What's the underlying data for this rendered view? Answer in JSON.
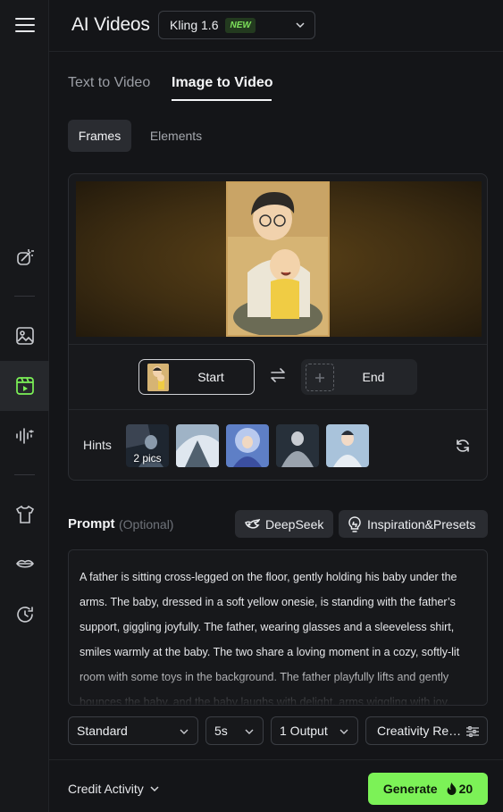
{
  "header": {
    "title": "AI Videos",
    "model": "Kling 1.6",
    "model_badge": "NEW"
  },
  "tabs": [
    {
      "label": "Text to Video",
      "active": false
    },
    {
      "label": "Image to Video",
      "active": true
    }
  ],
  "subtabs": [
    {
      "label": "Frames",
      "active": true
    },
    {
      "label": "Elements",
      "active": false
    }
  ],
  "frames": {
    "start_label": "Start",
    "end_label": "End"
  },
  "hints": {
    "label": "Hints",
    "count_badge": "2 pics"
  },
  "prompt": {
    "label": "Prompt",
    "optional": "(Optional)",
    "deepseek_label": "DeepSeek",
    "inspiration_label": "Inspiration&Presets",
    "text": "A father is sitting cross-legged on the floor, gently holding his baby under the arms. The baby, dressed in a soft yellow onesie, is standing with the father’s support, giggling joyfully. The father, wearing glasses and a sleeveless shirt, smiles warmly at the baby. The two share a loving moment in a cozy, softly-lit room with some toys in the background. The father playfully lifts and gently bounces the baby, and the baby laughs with delight, arms wiggling with joy."
  },
  "options": {
    "mode": "Standard",
    "duration": "5s",
    "outputs": "1 Output",
    "creativity": "Creativity Re…"
  },
  "footer": {
    "credit_label": "Credit Activity",
    "generate_label": "Generate",
    "generate_cost": "20"
  },
  "colors": {
    "accent_green": "#7cf257",
    "background": "#141518"
  },
  "icons": [
    "menu-icon",
    "magic-wand-icon",
    "image-icon",
    "video-icon",
    "audio-wave-icon",
    "shirt-icon",
    "lips-icon",
    "history-icon",
    "chevron-down-icon",
    "swap-icon",
    "plus-icon",
    "refresh-icon",
    "deepseek-whale-icon",
    "lightbulb-icon",
    "sliders-icon",
    "flame-icon"
  ]
}
